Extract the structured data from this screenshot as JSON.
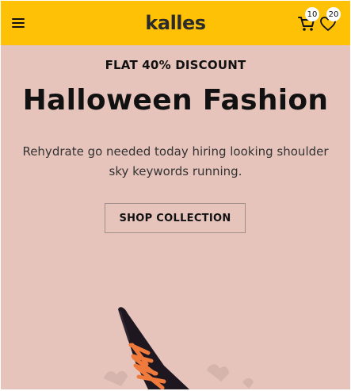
{
  "header": {
    "logo_text": "kalles",
    "cart_count": "10",
    "wishlist_count": "20"
  },
  "hero": {
    "kicker": "FLAT 40% DISCOUNT",
    "title": "Halloween Fashion",
    "description": "Rehydrate go needed today hiring looking shoulder sky keywords running.",
    "cta_label": "SHOP COLLECTION"
  },
  "colors": {
    "header_bg": "#ffc106",
    "hero_bg": "#e6c4bc",
    "hat_primary": "#1f1720",
    "hat_lace": "#f07a3b"
  },
  "icons": {
    "menu": "hamburger-menu-icon",
    "cart": "shopping-cart-icon",
    "wishlist": "heart-outline-icon"
  }
}
